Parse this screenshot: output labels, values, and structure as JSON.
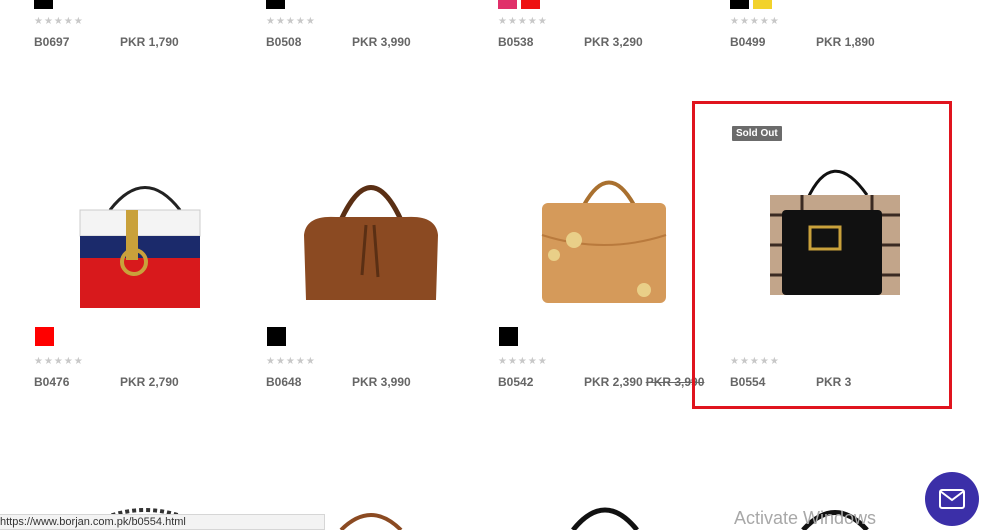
{
  "row_top": [
    {
      "sku": "B0697",
      "price": "PKR 1,790",
      "colors": [
        "#000000"
      ]
    },
    {
      "sku": "B0508",
      "price": "PKR 3,990",
      "colors": [
        "#000000"
      ]
    },
    {
      "sku": "B0538",
      "price": "PKR 3,290",
      "colors": [
        "#e0306a",
        "#ee1111"
      ]
    },
    {
      "sku": "B0499",
      "price": "PKR 1,890",
      "colors": [
        "#000000",
        "#f2d22b"
      ]
    }
  ],
  "row_main": [
    {
      "sku": "B0476",
      "price": "PKR 2,790",
      "colors": [
        "#ff0000"
      ],
      "image": "bag-white-blue-red-icon"
    },
    {
      "sku": "B0648",
      "price": "PKR 3,990",
      "colors": [
        "#000000"
      ],
      "image": "bag-brown-leather-icon"
    },
    {
      "sku": "B0542",
      "price": "PKR 2,390",
      "old_price": "PKR 3,990",
      "colors": [
        "#000000"
      ],
      "image": "bag-tan-floral-icon"
    },
    {
      "sku": "B0554",
      "price": "PKR 3",
      "colors": [],
      "badge": "Sold Out",
      "image": "bag-check-black-icon"
    }
  ],
  "rating_stars": "★★★★★",
  "status_url": "https://www.borjan.com.pk/b0554.html",
  "watermark": "Activate Windows",
  "colors": {
    "highlight": "#e0141e",
    "chat": "#3b2fa8",
    "sold_out": "#6b6b6b"
  }
}
